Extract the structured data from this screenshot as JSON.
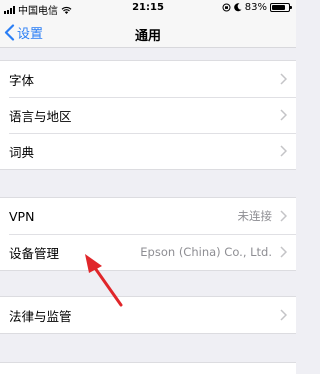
{
  "status_bar": {
    "carrier": "中国电信",
    "time": "21:15",
    "battery": "83%",
    "battery_level": 0.83
  },
  "nav": {
    "back_label": "设置",
    "title": "通用"
  },
  "group1": {
    "rows": [
      {
        "label": "字体"
      },
      {
        "label": "语言与地区"
      },
      {
        "label": "词典"
      }
    ]
  },
  "group2": {
    "rows": [
      {
        "label": "VPN",
        "value": "未连接"
      },
      {
        "label": "设备管理",
        "value": "Epson (China) Co., Ltd."
      }
    ]
  },
  "group3": {
    "rows": [
      {
        "label": "法律与监管"
      }
    ]
  },
  "colors": {
    "accent": "#2a7ef5",
    "annotation_arrow": "#e0262a"
  }
}
